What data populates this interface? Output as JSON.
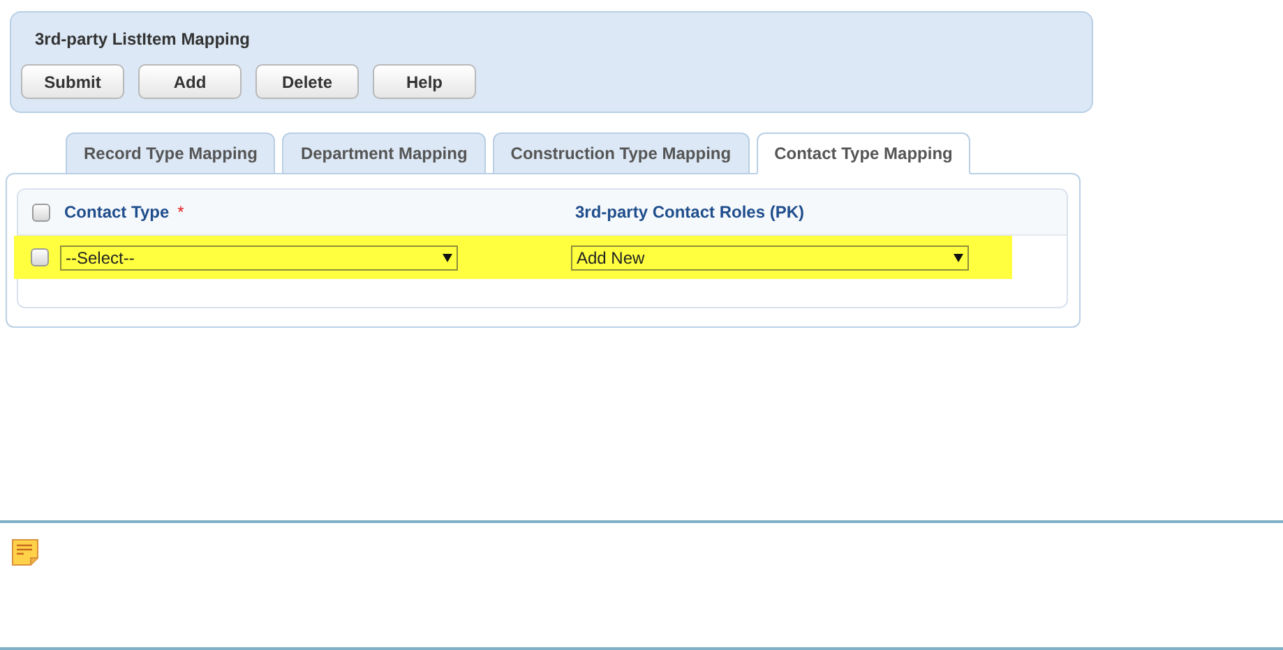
{
  "panel": {
    "title": "3rd-party ListItem Mapping",
    "buttons": [
      "Submit",
      "Add",
      "Delete",
      "Help"
    ]
  },
  "tabs": [
    {
      "label": "Record Type Mapping",
      "selected": false
    },
    {
      "label": "Department Mapping",
      "selected": false
    },
    {
      "label": "Construction Type Mapping",
      "selected": false
    },
    {
      "label": "Contact Type Mapping",
      "selected": true
    }
  ],
  "table": {
    "select_all": {
      "checked": false
    },
    "columns": [
      {
        "label": "Contact Type",
        "required_mark": "*"
      },
      {
        "label": "3rd-party Contact Roles (PK)"
      }
    ],
    "rows": [
      {
        "checked": false,
        "highlighted": true,
        "cells": [
          "--Select--",
          "Add New"
        ]
      }
    ]
  }
}
